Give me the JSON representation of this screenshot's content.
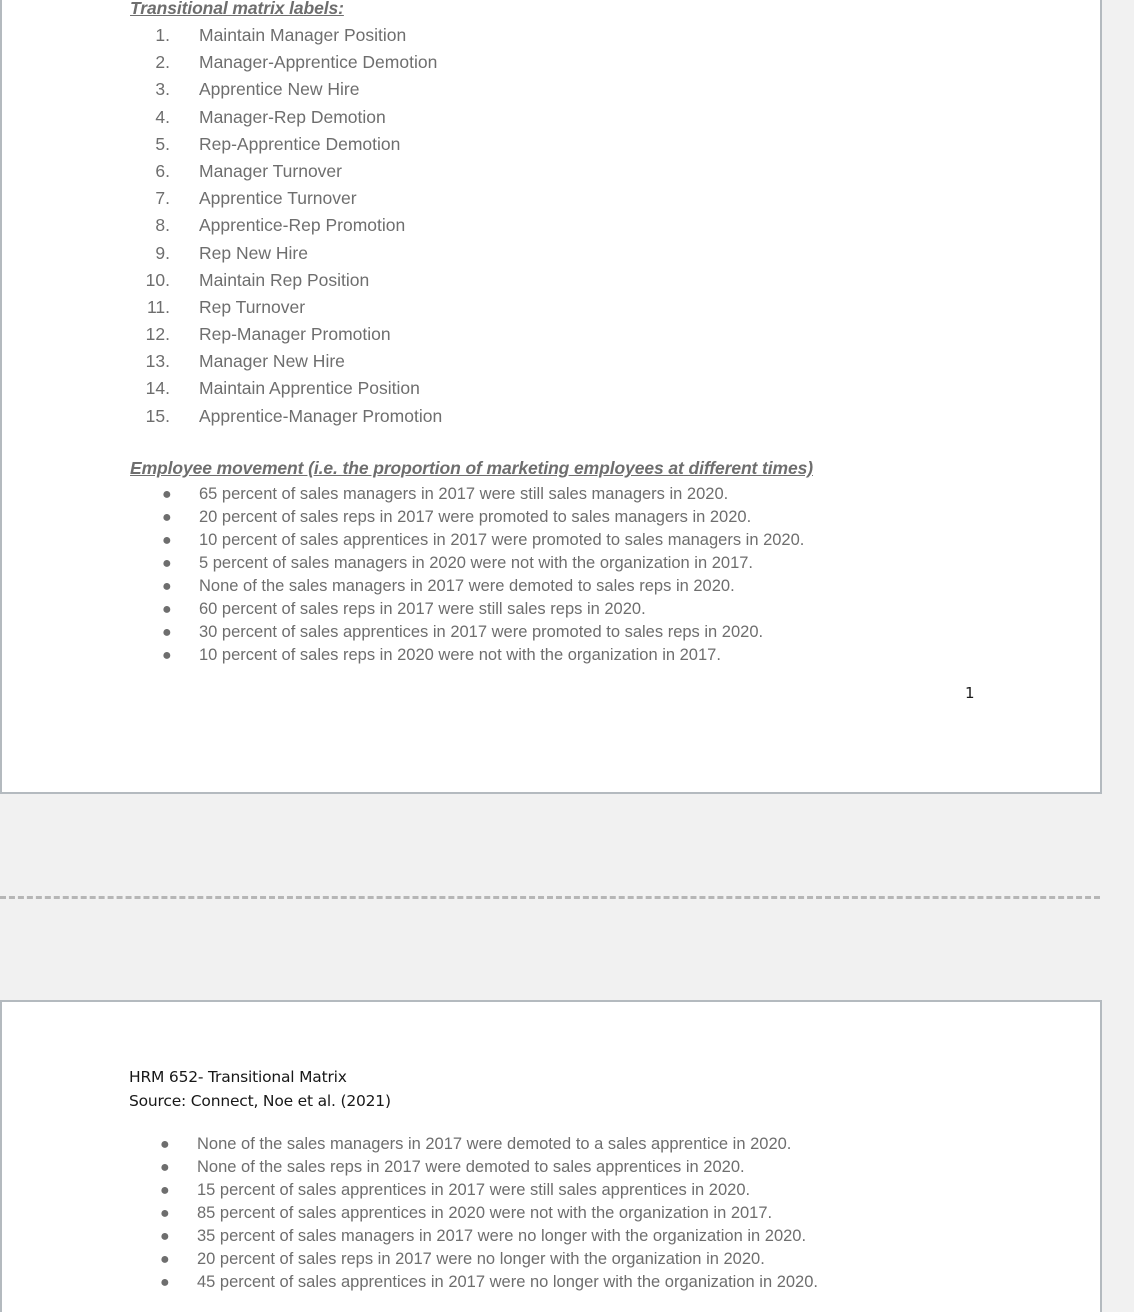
{
  "document": {
    "page1": {
      "labels_heading": "Transitional matrix labels:",
      "matrix_labels": [
        {
          "num": "1.",
          "text": "Maintain Manager Position"
        },
        {
          "num": "2.",
          "text": "Manager-Apprentice Demotion"
        },
        {
          "num": "3.",
          "text": "Apprentice New Hire"
        },
        {
          "num": "4.",
          "text": "Manager-Rep Demotion"
        },
        {
          "num": "5.",
          "text": "Rep-Apprentice Demotion"
        },
        {
          "num": "6.",
          "text": "Manager Turnover"
        },
        {
          "num": "7.",
          "text": "Apprentice Turnover"
        },
        {
          "num": "8.",
          "text": "Apprentice-Rep Promotion"
        },
        {
          "num": "9.",
          "text": "Rep New Hire"
        },
        {
          "num": "10.",
          "text": "Maintain Rep Position"
        },
        {
          "num": "11.",
          "text": "Rep Turnover"
        },
        {
          "num": "12.",
          "text": "Rep-Manager Promotion"
        },
        {
          "num": "13.",
          "text": "Manager New Hire"
        },
        {
          "num": "14.",
          "text": "Maintain Apprentice Position"
        },
        {
          "num": "15.",
          "text": "Apprentice-Manager Promotion"
        }
      ],
      "movement_heading": " Employee movement (i.e. the proportion of marketing employees at different times)",
      "movement_bullets": [
        "65 percent of sales managers in 2017 were still sales managers in 2020.",
        "20 percent of sales reps in 2017 were promoted to sales managers in 2020.",
        "10 percent of sales apprentices in 2017 were promoted to sales managers in 2020.",
        "5 percent of sales managers in 2020 were not with the organization in 2017.",
        "None of the sales managers in 2017 were demoted to sales reps in 2020.",
        "60 percent of sales reps in 2017 were still sales reps in 2020.",
        "30 percent of sales apprentices in 2017 were promoted to sales reps in 2020.",
        "10 percent of sales reps in 2020 were not with the organization in 2017."
      ],
      "page_number": "1"
    },
    "page2": {
      "header_line_1": "HRM 652- Transitional Matrix",
      "header_line_2": "Source: Connect, Noe et al. (2021)",
      "bullets": [
        "None of the sales managers in 2017 were demoted to a sales apprentice in 2020.",
        "None of the sales reps in 2017 were demoted to sales apprentices in 2020.",
        "15 percent of sales apprentices in 2017 were still sales apprentices in 2020.",
        "85 percent of sales apprentices in 2020 were not with the organization in 2017.",
        "35 percent of sales managers in 2017 were no longer with the organization in 2020.",
        "20 percent of sales reps in 2017 were no longer with the organization in 2020.",
        "45 percent of sales apprentices in 2017 were no longer with the organization in 2020."
      ]
    },
    "bullet_glyph": "●",
    "colors": {
      "page_background": "#ffffff",
      "canvas_background": "#f1f1f1",
      "page_border": "#b4babf",
      "body_text": "#6e6e6e",
      "header_text": "#181818",
      "separator": "#b6b6b6"
    }
  }
}
